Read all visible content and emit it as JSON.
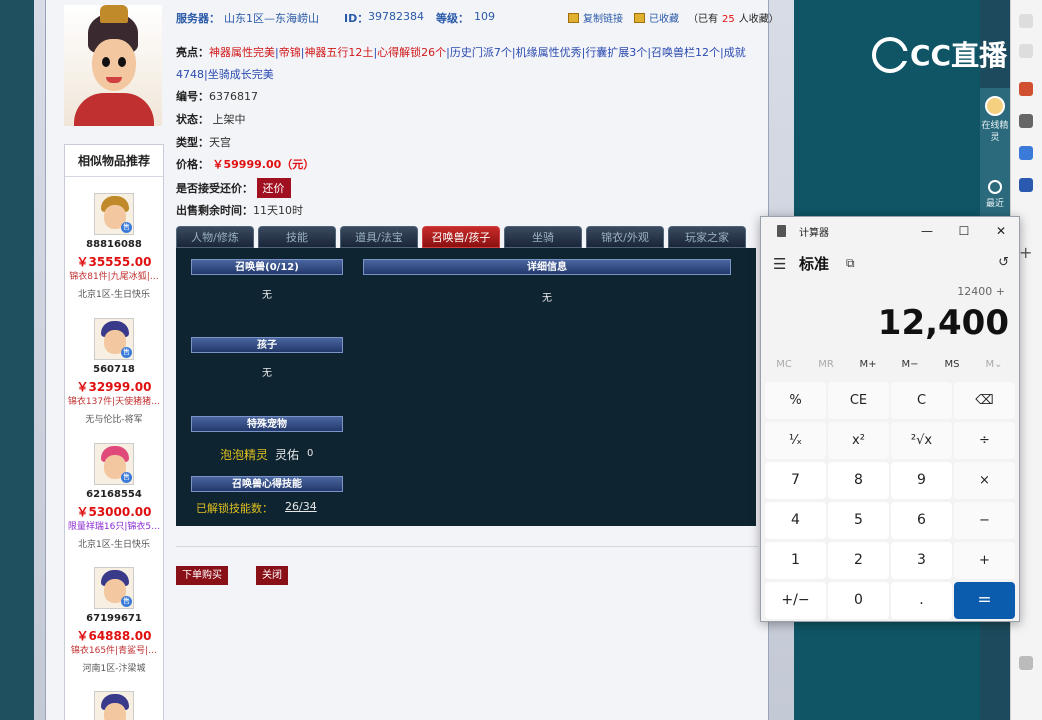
{
  "listing": {
    "server_label": "服务器：",
    "server_value": "山东1区—东海崂山",
    "id_label": "ID：",
    "id_value": "39782384",
    "level_label": "等级：",
    "level_value": "109",
    "copy_link": "复制链接",
    "favorited": "已收藏",
    "fav_count_prefix": "（已有",
    "fav_count": "25",
    "fav_count_suffix": "人收藏）",
    "highlights_label": "亮点：",
    "highlights": [
      {
        "text": "神器属性完美",
        "color": "red"
      },
      {
        "text": "|",
        "color": "blue"
      },
      {
        "text": "帝锦",
        "color": "red"
      },
      {
        "text": "|",
        "color": "blue"
      },
      {
        "text": "神器五行12土",
        "color": "red"
      },
      {
        "text": "|",
        "color": "blue"
      },
      {
        "text": "心得解锁26个",
        "color": "red"
      },
      {
        "text": "|",
        "color": "blue"
      },
      {
        "text": "历史门派7个",
        "color": "blue"
      },
      {
        "text": "|",
        "color": "blue"
      },
      {
        "text": "机缘属性优秀",
        "color": "blue"
      },
      {
        "text": "|",
        "color": "blue"
      },
      {
        "text": "行囊扩展3个",
        "color": "blue"
      },
      {
        "text": "|",
        "color": "blue"
      },
      {
        "text": "召唤兽栏12个",
        "color": "blue"
      },
      {
        "text": "|成就4748|坐骑成长完美",
        "color": "blue"
      }
    ],
    "serial_label": "编号：",
    "serial_value": "6376817",
    "status_label": "状态：",
    "status_value": "上架中",
    "type_label": "类型：",
    "type_value": "天宫",
    "price_label": "价格：",
    "price_value": "￥59999.00（元）",
    "bargain_label": "是否接受还价：",
    "bargain_button": "还价",
    "remaining_label": "出售剩余时间：",
    "remaining_value": "11天10时"
  },
  "tabs": [
    {
      "label": "人物/修炼",
      "active": false
    },
    {
      "label": "技能",
      "active": false
    },
    {
      "label": "道具/法宝",
      "active": false
    },
    {
      "label": "召唤兽/孩子",
      "active": true
    },
    {
      "label": "坐骑",
      "active": false
    },
    {
      "label": "锦衣/外观",
      "active": false
    },
    {
      "label": "玩家之家",
      "active": false
    }
  ],
  "pet_panel": {
    "pets_header": "召唤兽(0/12)",
    "pets_value": "无",
    "detail_header": "详细信息",
    "detail_value": "无",
    "child_header": "孩子",
    "child_value": "无",
    "special_header": "特殊宠物",
    "special_name": "泡泡精灵",
    "special_kind": "灵佑",
    "special_count": "0",
    "skill_header": "召唤兽心得技能",
    "unlocked_label": "已解锁技能数：",
    "unlocked_value": "26/34"
  },
  "actions": {
    "buy": "下单购买",
    "close": "关闭"
  },
  "recommend": {
    "title": "相似物品推荐",
    "items": [
      {
        "id": "88816088",
        "price": "￥35555.00",
        "desc": "锦衣81件|九尾冰狐|…",
        "desc_color": "red",
        "server": "北京1区-生日快乐"
      },
      {
        "id": "560718",
        "price": "￥32999.00",
        "desc": "锦衣137件|天使猪猪…",
        "desc_color": "red",
        "server": "无与伦比-将军"
      },
      {
        "id": "62168554",
        "price": "￥53000.00",
        "desc": "限量祥瑞16只|锦衣5…",
        "desc_color": "purple",
        "server": "北京1区-生日快乐"
      },
      {
        "id": "67199671",
        "price": "￥64888.00",
        "desc": "锦衣165件|青鲨号|…",
        "desc_color": "red",
        "server": "河南1区-汴梁城"
      }
    ]
  },
  "stream": {
    "logo_text": "CC直播",
    "side_online": "在线精灵",
    "side_recent": "最近"
  },
  "calculator": {
    "title": "计算器",
    "mode": "标准",
    "expression": "12400 +",
    "display": "12,400",
    "memory": [
      "MC",
      "MR",
      "M+",
      "M−",
      "MS",
      "M⌄"
    ],
    "keys": [
      [
        "%",
        "CE",
        "C",
        "⌫"
      ],
      [
        "¹⁄ₓ",
        "x²",
        "²√x",
        "÷"
      ],
      [
        "7",
        "8",
        "9",
        "×"
      ],
      [
        "4",
        "5",
        "6",
        "−"
      ],
      [
        "1",
        "2",
        "3",
        "+"
      ],
      [
        "+/−",
        "0",
        ".",
        "="
      ]
    ]
  }
}
